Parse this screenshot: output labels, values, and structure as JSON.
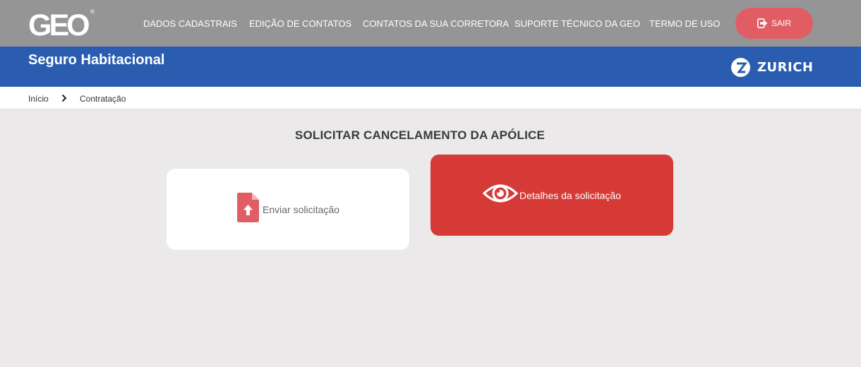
{
  "brand": {
    "logo": "GEO",
    "registered": "®"
  },
  "nav": {
    "items": [
      "DADOS CADASTRAIS",
      "EDIÇÃO DE CONTATOS",
      "CONTATOS DA SUA CORRETORA",
      "SUPORTE TÉCNICO DA GEO",
      "TERMO DE USO"
    ],
    "logout_label": "SAIR"
  },
  "banner": {
    "title": "Seguro Habitacional",
    "partner": "ZURICH"
  },
  "breadcrumb": {
    "items": [
      "Início",
      "Contratação"
    ]
  },
  "main": {
    "heading": "SOLICITAR CANCELAMENTO DA APÓLICE",
    "cards": {
      "send": {
        "label": "Enviar solicitação",
        "icon": "file-upload-icon"
      },
      "details": {
        "label": "Detalhes da solicitação",
        "icon": "eye-icon"
      }
    }
  },
  "colors": {
    "topbar": "#959595",
    "banner": "#2a5db0",
    "logout": "#e05d63",
    "details_card": "#d63a36",
    "upload_icon": "#e05d63",
    "page_bg": "#ebe9e9"
  }
}
